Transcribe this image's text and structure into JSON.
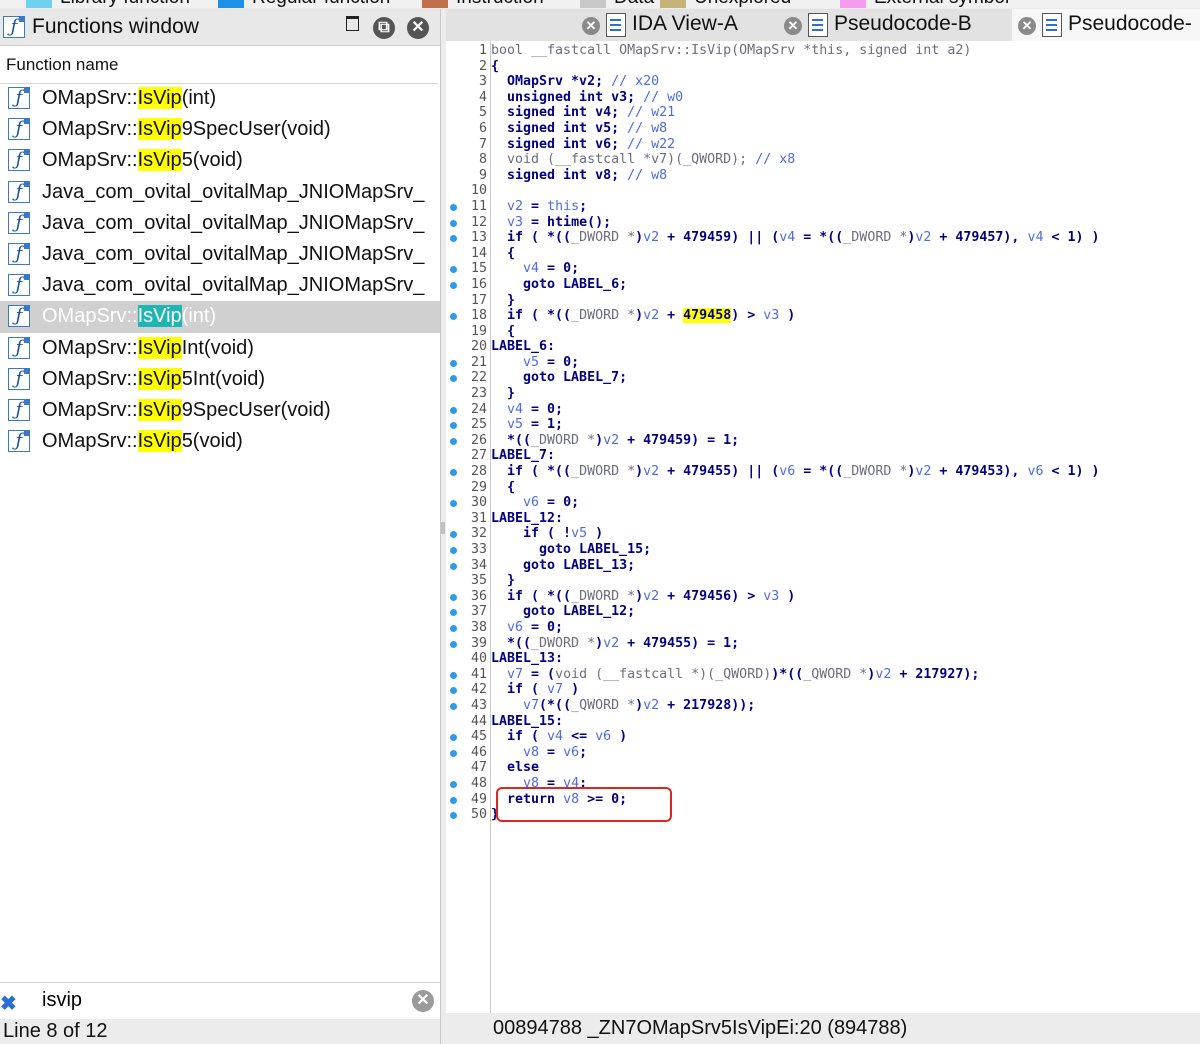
{
  "legend": [
    {
      "label": "Library function",
      "color": "#6fd0f0"
    },
    {
      "label": "Regular function",
      "color": "#1e90e8"
    },
    {
      "label": "Instruction",
      "color": "#c0704a"
    },
    {
      "label": "Data",
      "color": "#c8c8c8"
    },
    {
      "label": "Unexplored",
      "color": "#c5b37a"
    },
    {
      "label": "External symbol",
      "color": "#f39cf0"
    }
  ],
  "functions_window": {
    "title": "Functions window",
    "column_header": "Function name",
    "items": [
      {
        "pre": "OMapSrv::",
        "hl": "IsVip",
        "post": "(int)"
      },
      {
        "pre": "OMapSrv::",
        "hl": "IsVip",
        "post": "9SpecUser(void)"
      },
      {
        "pre": "OMapSrv::",
        "hl": "IsVip",
        "post": "5(void)"
      },
      {
        "pre": "Java_com_ovital_ovitalMap_JNIOMapSrv_",
        "hl": "",
        "post": ""
      },
      {
        "pre": "Java_com_ovital_ovitalMap_JNIOMapSrv_",
        "hl": "",
        "post": ""
      },
      {
        "pre": "Java_com_ovital_ovitalMap_JNIOMapSrv_",
        "hl": "",
        "post": ""
      },
      {
        "pre": "Java_com_ovital_ovitalMap_JNIOMapSrv_",
        "hl": "",
        "post": ""
      },
      {
        "pre": "OMapSrv::",
        "hl": "IsVip",
        "post": "(int)",
        "selected": true
      },
      {
        "pre": "OMapSrv::",
        "hl": "IsVip",
        "post": "Int(void)"
      },
      {
        "pre": "OMapSrv::",
        "hl": "IsVip",
        "post": "5Int(void)"
      },
      {
        "pre": "OMapSrv::",
        "hl": "IsVip",
        "post": "9SpecUser(void)"
      },
      {
        "pre": "OMapSrv::",
        "hl": "IsVip",
        "post": "5(void)"
      }
    ],
    "search_value": "isvip",
    "status": "Line 8 of 12"
  },
  "tabs": [
    {
      "label": "IDA View-A"
    },
    {
      "label": "Pseudocode-B"
    },
    {
      "label": "Pseudocode-"
    }
  ],
  "code_lines": [
    {
      "n": "1",
      "dot": false,
      "segs": [
        [
          "bool __fastcall ",
          "dim"
        ],
        [
          "OMapSrv::IsVip(OMapSrv *this, signed int a2)",
          "dim"
        ]
      ]
    },
    {
      "n": "2",
      "dot": false,
      "segs": [
        [
          "{",
          "kw"
        ]
      ]
    },
    {
      "n": "3",
      "dot": false,
      "segs": [
        [
          "  OMapSrv *v2; ",
          "kw"
        ],
        [
          "// x20",
          "var"
        ]
      ]
    },
    {
      "n": "4",
      "dot": false,
      "segs": [
        [
          "  unsigned int v3; ",
          "kw"
        ],
        [
          "// w0",
          "var"
        ]
      ]
    },
    {
      "n": "5",
      "dot": false,
      "segs": [
        [
          "  signed int v4; ",
          "kw"
        ],
        [
          "// w21",
          "var"
        ]
      ]
    },
    {
      "n": "6",
      "dot": false,
      "segs": [
        [
          "  signed int v5; ",
          "kw"
        ],
        [
          "// w8",
          "var"
        ]
      ]
    },
    {
      "n": "7",
      "dot": false,
      "segs": [
        [
          "  signed int v6; ",
          "kw"
        ],
        [
          "// w22",
          "var"
        ]
      ]
    },
    {
      "n": "8",
      "dot": false,
      "segs": [
        [
          "  void (__fastcall *v7)(_QWORD); ",
          "dim"
        ],
        [
          "// x8",
          "var"
        ]
      ]
    },
    {
      "n": "9",
      "dot": false,
      "segs": [
        [
          "  signed int v8; ",
          "kw"
        ],
        [
          "// w8",
          "var"
        ]
      ]
    },
    {
      "n": "10",
      "dot": false,
      "segs": []
    },
    {
      "n": "11",
      "dot": true,
      "segs": [
        [
          "  ",
          "kw"
        ],
        [
          "v2",
          "var"
        ],
        [
          " = ",
          "kw"
        ],
        [
          "this",
          "var"
        ],
        [
          ";",
          "kw"
        ]
      ]
    },
    {
      "n": "12",
      "dot": true,
      "segs": [
        [
          "  ",
          "kw"
        ],
        [
          "v3",
          "var"
        ],
        [
          " = htime();",
          "kw"
        ]
      ]
    },
    {
      "n": "13",
      "dot": true,
      "segs": [
        [
          "  if ( *((",
          "kw"
        ],
        [
          "_DWORD *",
          "dim"
        ],
        [
          ")",
          "kw"
        ],
        [
          "v2",
          "var"
        ],
        [
          " + 479459) || (",
          "kw"
        ],
        [
          "v4",
          "var"
        ],
        [
          " = *((",
          "kw"
        ],
        [
          "_DWORD *",
          "dim"
        ],
        [
          ")",
          "kw"
        ],
        [
          "v2",
          "var"
        ],
        [
          " + 479457), ",
          "kw"
        ],
        [
          "v4",
          "var"
        ],
        [
          " < 1) )",
          "kw"
        ]
      ]
    },
    {
      "n": "14",
      "dot": false,
      "segs": [
        [
          "  {",
          "kw"
        ]
      ]
    },
    {
      "n": "15",
      "dot": true,
      "segs": [
        [
          "    ",
          "kw"
        ],
        [
          "v4",
          "var"
        ],
        [
          " = 0;",
          "kw"
        ]
      ]
    },
    {
      "n": "16",
      "dot": true,
      "segs": [
        [
          "    goto LABEL_6;",
          "kw"
        ]
      ]
    },
    {
      "n": "17",
      "dot": false,
      "segs": [
        [
          "  }",
          "kw"
        ]
      ]
    },
    {
      "n": "18",
      "dot": true,
      "segs": [
        [
          "  if ( *((",
          "kw"
        ],
        [
          "_DWORD *",
          "dim"
        ],
        [
          ")",
          "kw"
        ],
        [
          "v2",
          "var"
        ],
        [
          " + ",
          "kw"
        ],
        [
          "479458",
          "yl"
        ],
        [
          ") > ",
          "kw"
        ],
        [
          "v3",
          "var"
        ],
        [
          " )",
          "kw"
        ]
      ]
    },
    {
      "n": "19",
      "dot": false,
      "segs": [
        [
          "  {",
          "kw"
        ]
      ]
    },
    {
      "n": "20",
      "dot": false,
      "segs": [
        [
          "LABEL_6:",
          "kw"
        ]
      ]
    },
    {
      "n": "21",
      "dot": true,
      "segs": [
        [
          "    ",
          "kw"
        ],
        [
          "v5",
          "var"
        ],
        [
          " = 0;",
          "kw"
        ]
      ]
    },
    {
      "n": "22",
      "dot": true,
      "segs": [
        [
          "    goto LABEL_7;",
          "kw"
        ]
      ]
    },
    {
      "n": "23",
      "dot": false,
      "segs": [
        [
          "  }",
          "kw"
        ]
      ]
    },
    {
      "n": "24",
      "dot": true,
      "segs": [
        [
          "  ",
          "kw"
        ],
        [
          "v4",
          "var"
        ],
        [
          " = 0;",
          "kw"
        ]
      ]
    },
    {
      "n": "25",
      "dot": true,
      "segs": [
        [
          "  ",
          "kw"
        ],
        [
          "v5",
          "var"
        ],
        [
          " = 1;",
          "kw"
        ]
      ]
    },
    {
      "n": "26",
      "dot": true,
      "segs": [
        [
          "  *((",
          "kw"
        ],
        [
          "_DWORD *",
          "dim"
        ],
        [
          ")",
          "kw"
        ],
        [
          "v2",
          "var"
        ],
        [
          " + 479459) = 1;",
          "kw"
        ]
      ]
    },
    {
      "n": "27",
      "dot": false,
      "segs": [
        [
          "LABEL_7:",
          "kw"
        ]
      ]
    },
    {
      "n": "28",
      "dot": true,
      "segs": [
        [
          "  if ( *((",
          "kw"
        ],
        [
          "_DWORD *",
          "dim"
        ],
        [
          ")",
          "kw"
        ],
        [
          "v2",
          "var"
        ],
        [
          " + 479455) || (",
          "kw"
        ],
        [
          "v6",
          "var"
        ],
        [
          " = *((",
          "kw"
        ],
        [
          "_DWORD *",
          "dim"
        ],
        [
          ")",
          "kw"
        ],
        [
          "v2",
          "var"
        ],
        [
          " + 479453), ",
          "kw"
        ],
        [
          "v6",
          "var"
        ],
        [
          " < 1) )",
          "kw"
        ]
      ]
    },
    {
      "n": "29",
      "dot": false,
      "segs": [
        [
          "  {",
          "kw"
        ]
      ]
    },
    {
      "n": "30",
      "dot": true,
      "segs": [
        [
          "    ",
          "kw"
        ],
        [
          "v6",
          "var"
        ],
        [
          " = 0;",
          "kw"
        ]
      ]
    },
    {
      "n": "31",
      "dot": false,
      "segs": [
        [
          "LABEL_12:",
          "kw"
        ]
      ]
    },
    {
      "n": "32",
      "dot": true,
      "segs": [
        [
          "    if ( !",
          "kw"
        ],
        [
          "v5",
          "var"
        ],
        [
          " )",
          "kw"
        ]
      ]
    },
    {
      "n": "33",
      "dot": true,
      "segs": [
        [
          "      goto LABEL_15;",
          "kw"
        ]
      ]
    },
    {
      "n": "34",
      "dot": true,
      "segs": [
        [
          "    goto LABEL_13;",
          "kw"
        ]
      ]
    },
    {
      "n": "35",
      "dot": false,
      "segs": [
        [
          "  }",
          "kw"
        ]
      ]
    },
    {
      "n": "36",
      "dot": true,
      "segs": [
        [
          "  if ( *((",
          "kw"
        ],
        [
          "_DWORD *",
          "dim"
        ],
        [
          ")",
          "kw"
        ],
        [
          "v2",
          "var"
        ],
        [
          " + 479456) > ",
          "kw"
        ],
        [
          "v3",
          "var"
        ],
        [
          " )",
          "kw"
        ]
      ]
    },
    {
      "n": "37",
      "dot": true,
      "segs": [
        [
          "    goto LABEL_12;",
          "kw"
        ]
      ]
    },
    {
      "n": "38",
      "dot": true,
      "segs": [
        [
          "  ",
          "kw"
        ],
        [
          "v6",
          "var"
        ],
        [
          " = 0;",
          "kw"
        ]
      ]
    },
    {
      "n": "39",
      "dot": true,
      "segs": [
        [
          "  *((",
          "kw"
        ],
        [
          "_DWORD *",
          "dim"
        ],
        [
          ")",
          "kw"
        ],
        [
          "v2",
          "var"
        ],
        [
          " + 479455) = 1;",
          "kw"
        ]
      ]
    },
    {
      "n": "40",
      "dot": false,
      "segs": [
        [
          "LABEL_13:",
          "kw"
        ]
      ]
    },
    {
      "n": "41",
      "dot": true,
      "segs": [
        [
          "  ",
          "kw"
        ],
        [
          "v7",
          "var"
        ],
        [
          " = (",
          "kw"
        ],
        [
          "void (__fastcall *)(_QWORD)",
          "dim"
        ],
        [
          ")*((",
          "kw"
        ],
        [
          "_QWORD *",
          "dim"
        ],
        [
          ")",
          "kw"
        ],
        [
          "v2",
          "var"
        ],
        [
          " + 217927);",
          "kw"
        ]
      ]
    },
    {
      "n": "42",
      "dot": true,
      "segs": [
        [
          "  if ( ",
          "kw"
        ],
        [
          "v7",
          "var"
        ],
        [
          " )",
          "kw"
        ]
      ]
    },
    {
      "n": "43",
      "dot": true,
      "segs": [
        [
          "    ",
          "kw"
        ],
        [
          "v7",
          "var"
        ],
        [
          "(*((",
          "kw"
        ],
        [
          "_QWORD *",
          "dim"
        ],
        [
          ")",
          "kw"
        ],
        [
          "v2",
          "var"
        ],
        [
          " + 217928));",
          "kw"
        ]
      ]
    },
    {
      "n": "44",
      "dot": false,
      "segs": [
        [
          "LABEL_15:",
          "kw"
        ]
      ]
    },
    {
      "n": "45",
      "dot": true,
      "segs": [
        [
          "  if ( ",
          "kw"
        ],
        [
          "v4",
          "var"
        ],
        [
          " <= ",
          "kw"
        ],
        [
          "v6",
          "var"
        ],
        [
          " )",
          "kw"
        ]
      ]
    },
    {
      "n": "46",
      "dot": true,
      "segs": [
        [
          "    ",
          "kw"
        ],
        [
          "v8",
          "var"
        ],
        [
          " = ",
          "kw"
        ],
        [
          "v6",
          "var"
        ],
        [
          ";",
          "kw"
        ]
      ]
    },
    {
      "n": "47",
      "dot": false,
      "segs": [
        [
          "  else",
          "kw"
        ]
      ]
    },
    {
      "n": "48",
      "dot": true,
      "segs": [
        [
          "    ",
          "kw"
        ],
        [
          "v8",
          "var"
        ],
        [
          " = ",
          "kw"
        ],
        [
          "v4",
          "var"
        ],
        [
          ";",
          "kw"
        ]
      ]
    },
    {
      "n": "49",
      "dot": true,
      "segs": [
        [
          "  return ",
          "kw"
        ],
        [
          "v8",
          "var"
        ],
        [
          " >= 0;",
          "kw"
        ]
      ]
    },
    {
      "n": "50",
      "dot": true,
      "segs": [
        [
          "}",
          "kw"
        ]
      ]
    }
  ],
  "status_right": "00894788 _ZN7OMapSrv5IsVipEi:20 (894788)"
}
